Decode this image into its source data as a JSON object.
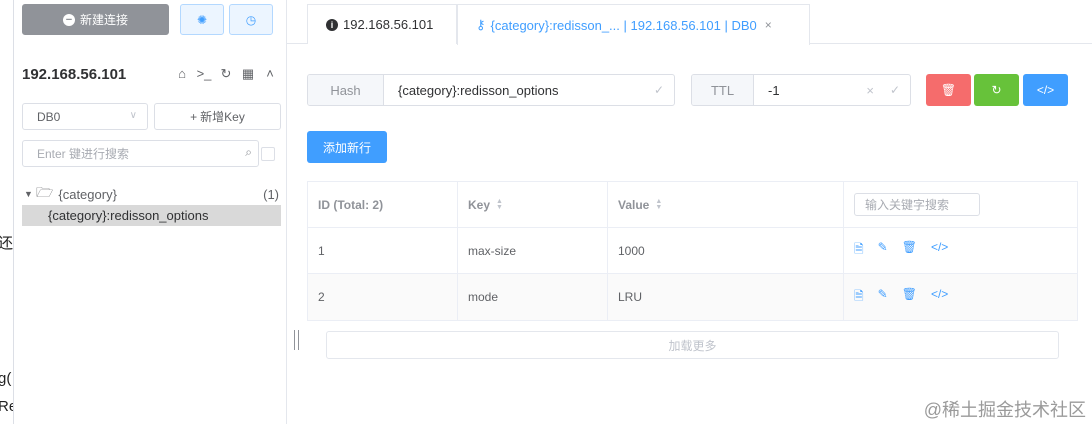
{
  "edge": {
    "fragments": [
      "还",
      "g(",
      "Re"
    ]
  },
  "sidebar": {
    "new_connection_label": "新建连接",
    "connection_name": "192.168.56.101",
    "connection_icons": [
      "home-icon",
      "terminal-icon",
      "refresh-icon",
      "grid-icon",
      "chevron-up-icon"
    ],
    "db_select_value": "DB0",
    "new_key_label": "新增Key",
    "search_placeholder": "Enter 键进行搜索",
    "tree": {
      "folder_name": "{category}",
      "folder_count": "(1)",
      "keys": [
        "{category}:redisson_options"
      ]
    }
  },
  "tabs": [
    {
      "label": "192.168.56.101",
      "icon": "info-icon",
      "active": false
    },
    {
      "label": "{category}:redisson_... | 192.168.56.101 | DB0",
      "icon": "key-icon",
      "active": true
    }
  ],
  "key_detail": {
    "type_label": "Hash",
    "key_name": "{category}:redisson_options",
    "ttl_label": "TTL",
    "ttl_value": "-1",
    "add_row_label": "添加新行"
  },
  "table": {
    "headers": [
      "ID (Total: 2)",
      "Key",
      "Value"
    ],
    "filter_placeholder": "输入关键字搜索",
    "rows": [
      {
        "id": "1",
        "key": "max-size",
        "value": "1000"
      },
      {
        "id": "2",
        "key": "mode",
        "value": "LRU"
      }
    ],
    "load_more_label": "加载更多"
  },
  "watermark": "@稀土掘金技术社区",
  "colors": {
    "primary": "#409eff",
    "danger": "#f56c6c",
    "success": "#67c23a",
    "info": "#909399"
  }
}
